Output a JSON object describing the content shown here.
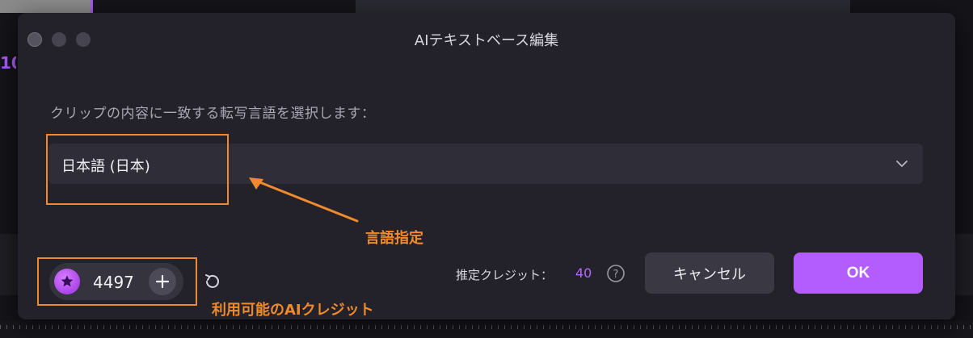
{
  "background": {
    "partial_text": "10"
  },
  "dialog": {
    "title": "AIテキストベース編集",
    "prompt": "クリップの内容に一致する転写言語を選択します：",
    "language_select": {
      "value": "日本語 (日本)"
    },
    "credits": {
      "available": "4497"
    },
    "estimate": {
      "label": "推定クレジット：",
      "value": "40"
    },
    "buttons": {
      "cancel": "キャンセル",
      "ok": "OK"
    }
  },
  "annotations": {
    "language": "言語指定",
    "credits": "利用可能のAIクレジット"
  },
  "colors": {
    "accent": "#b35cff",
    "annotation": "#f08a2c",
    "dialog_bg": "#23222b"
  },
  "icons": {
    "select": "chevron-down-icon",
    "credit": "star-icon",
    "add": "plus-icon",
    "refresh": "refresh-icon",
    "help": "question-icon"
  }
}
